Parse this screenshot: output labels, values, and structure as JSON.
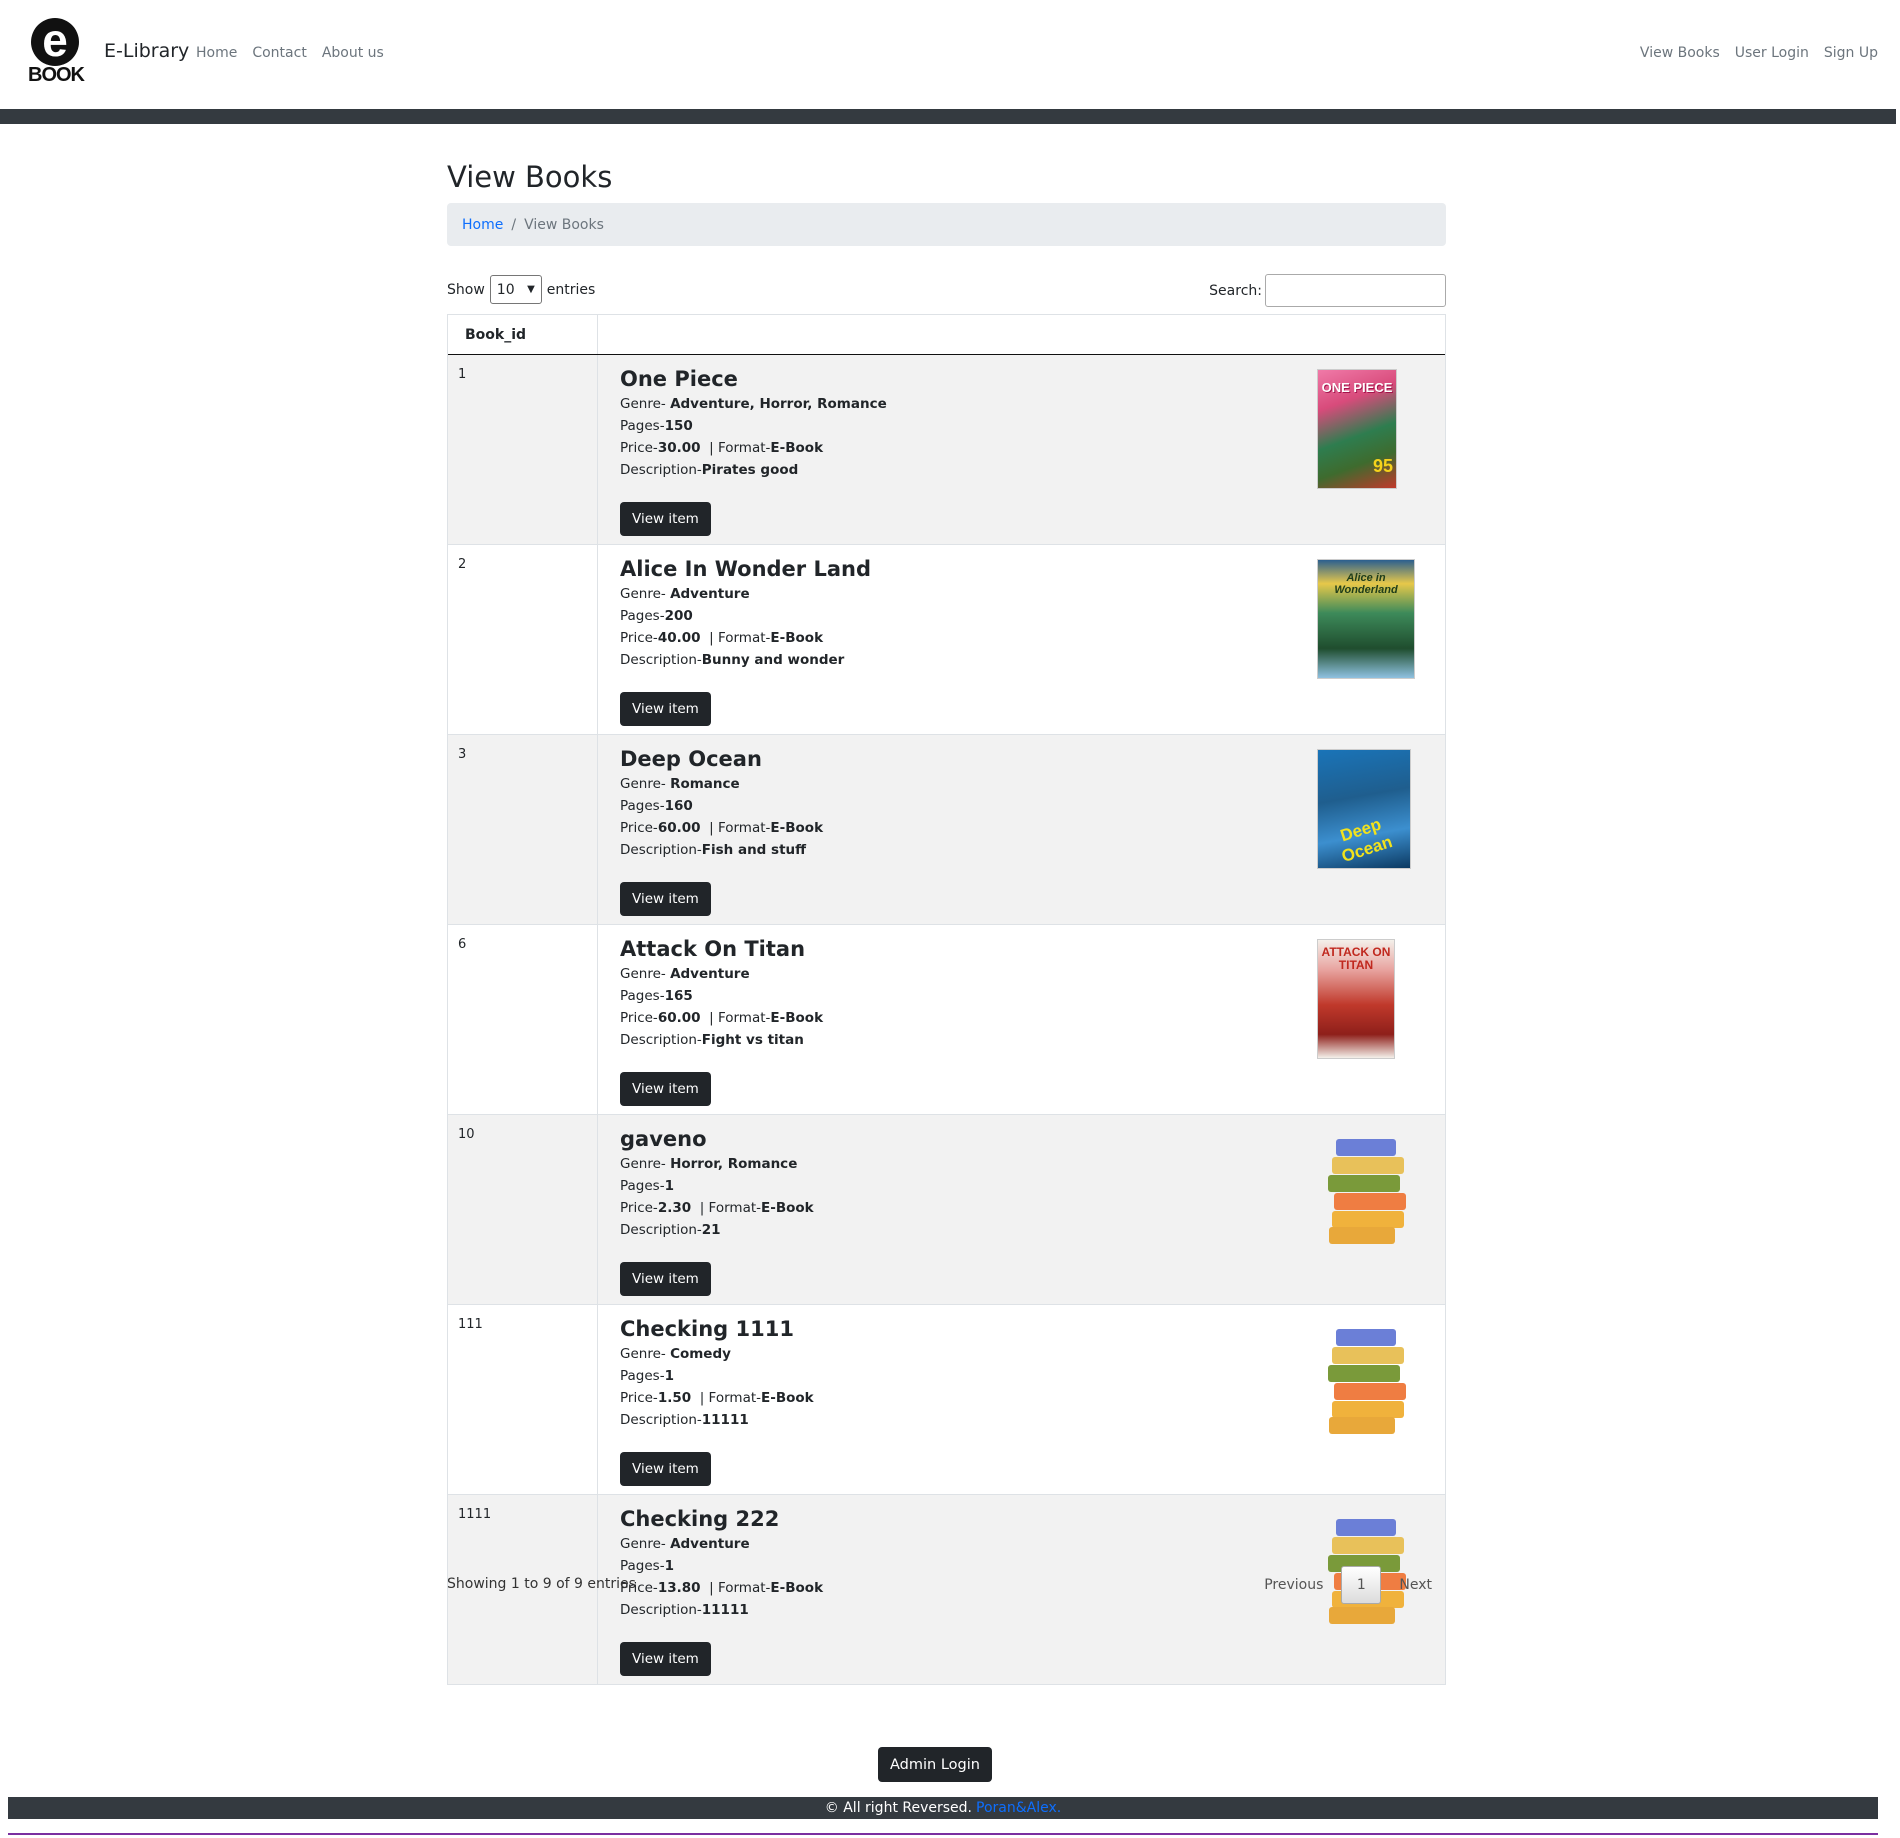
{
  "navbar": {
    "logo_letter": "e",
    "logo_word": "BOOK",
    "brand": "E-Library",
    "left_links": [
      "Home",
      "Contact",
      "About us"
    ],
    "right_links": [
      "View Books",
      "User Login",
      "Sign Up"
    ]
  },
  "page": {
    "title": "View Books",
    "breadcrumb": {
      "home": "Home",
      "separator": "/",
      "current": "View Books"
    }
  },
  "table_controls": {
    "show_label": "Show",
    "entries_value": "10",
    "entries_label": "entries",
    "search_label": "Search:",
    "search_value": ""
  },
  "table": {
    "columns": [
      "Book_id",
      ""
    ],
    "view_button_label": "View item",
    "rows": [
      {
        "id": "1",
        "title": "One Piece",
        "genre_label": "Genre-",
        "genre": "Adventure, Horror, Romance",
        "pages_label": "Pages-",
        "pages": "150",
        "price_label": "Price-",
        "price": "30.00",
        "format_label": "| Format-",
        "format": "E-Book",
        "desc_label": "Description-",
        "description": "Pirates good",
        "cover": "one-piece-cover"
      },
      {
        "id": "2",
        "title": "Alice In Wonder Land",
        "genre_label": "Genre-",
        "genre": "Adventure",
        "pages_label": "Pages-",
        "pages": "200",
        "price_label": "Price-",
        "price": "40.00",
        "format_label": "| Format-",
        "format": "E-Book",
        "desc_label": "Description-",
        "description": "Bunny and wonder",
        "cover": "alice-cover"
      },
      {
        "id": "3",
        "title": "Deep Ocean",
        "genre_label": "Genre-",
        "genre": "Romance",
        "pages_label": "Pages-",
        "pages": "160",
        "price_label": "Price-",
        "price": "60.00",
        "format_label": "| Format-",
        "format": "E-Book",
        "desc_label": "Description-",
        "description": "Fish and stuff",
        "cover": "deep-ocean-cover"
      },
      {
        "id": "6",
        "title": "Attack On Titan",
        "genre_label": "Genre-",
        "genre": "Adventure",
        "pages_label": "Pages-",
        "pages": "165",
        "price_label": "Price-",
        "price": "60.00",
        "format_label": "| Format-",
        "format": "E-Book",
        "desc_label": "Description-",
        "description": "Fight vs titan",
        "cover": "attack-on-titan-cover"
      },
      {
        "id": "10",
        "title": "gaveno",
        "genre_label": "Genre-",
        "genre": "Horror, Romance",
        "pages_label": "Pages-",
        "pages": "1",
        "price_label": "Price-",
        "price": "2.30",
        "format_label": "| Format-",
        "format": "E-Book",
        "desc_label": "Description-",
        "description": "21",
        "cover": "book-stack-icon"
      },
      {
        "id": "111",
        "title": "Checking 1111",
        "genre_label": "Genre-",
        "genre": "Comedy",
        "pages_label": "Pages-",
        "pages": "1",
        "price_label": "Price-",
        "price": "1.50",
        "format_label": "| Format-",
        "format": "E-Book",
        "desc_label": "Description-",
        "description": "11111",
        "cover": "book-stack-icon"
      },
      {
        "id": "1111",
        "title": "Checking 222",
        "genre_label": "Genre-",
        "genre": "Adventure",
        "pages_label": "Pages-",
        "pages": "1",
        "price_label": "Price-",
        "price": "13.80",
        "format_label": "| Format-",
        "format": "E-Book",
        "desc_label": "Description-",
        "description": "11111",
        "cover": "book-stack-icon"
      }
    ]
  },
  "cover_text": {
    "one_piece": "ONE PIECE",
    "one_piece_volume": "95",
    "alice": "Alice in Wonderland",
    "deep_ocean": "Deep Ocean",
    "attack_on_titan": "ATTACK ON TITAN"
  },
  "pagination": {
    "info": "Showing 1 to 9 of 9 entries",
    "previous": "Previous",
    "current": "1",
    "next": "Next"
  },
  "admin_button": "Admin Login",
  "footer": {
    "text": "© All right Reversed.",
    "link": "Poran&Alex."
  },
  "colors": {
    "navbar_divider": "#343a40",
    "button_bg": "#212529",
    "link": "#0d6efd",
    "row_stripe": "#f2f2f2"
  }
}
